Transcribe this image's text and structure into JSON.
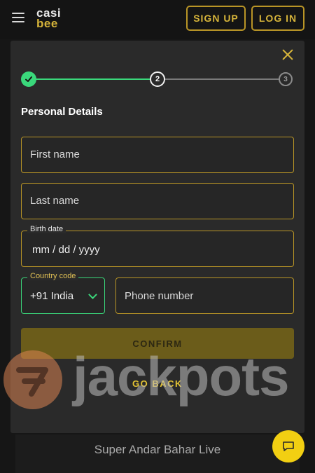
{
  "header": {
    "logo_line1": "casi",
    "logo_line2": "bee",
    "signup_label": "SIGN UP",
    "login_label": "LOG IN"
  },
  "steps": {
    "step2": "2",
    "step3": "3"
  },
  "form": {
    "title": "Personal Details",
    "first_name_placeholder": "First name",
    "last_name_placeholder": "Last name",
    "birth_date_label": "Birth date",
    "birth_date_value": "mm / dd / yyyy",
    "country_code_label": "Country code",
    "country_code_value": "+91 India",
    "phone_placeholder": "Phone number",
    "confirm_label": "CONFIRM",
    "go_back_label": "GO BACK"
  },
  "background": {
    "game_title": "Super Andar Bahar Live"
  },
  "watermark": {
    "text": "jackpots"
  },
  "colors": {
    "accent_gold": "#d6b43a",
    "success_green": "#3ad87b",
    "chat_yellow": "#f2cf12"
  },
  "icons": [
    "menu-icon",
    "close-icon",
    "check-icon",
    "chevron-down-icon",
    "chat-icon"
  ]
}
